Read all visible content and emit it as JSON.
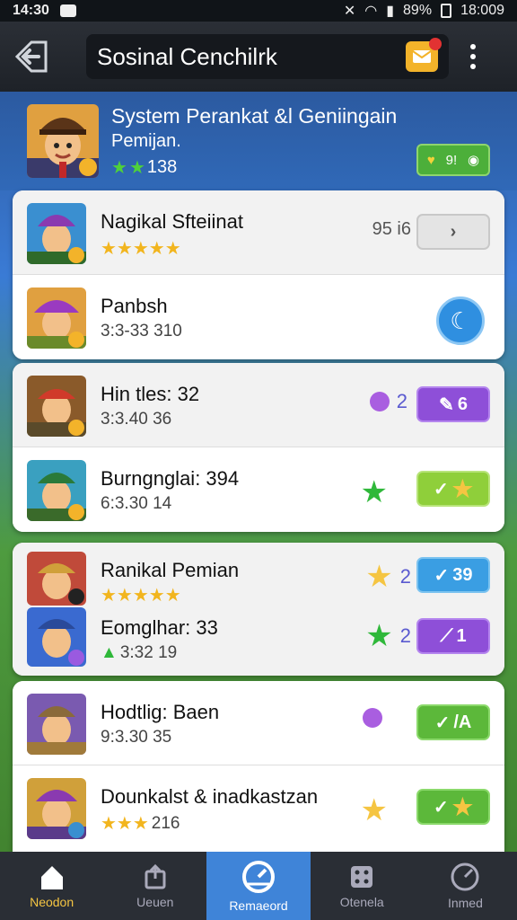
{
  "status": {
    "time": "14:30",
    "battery": "89%",
    "clock": "18:009"
  },
  "header": {
    "title": "Sosinal Cenchilrk"
  },
  "profile": {
    "title": "System Perankat &l Geniingain",
    "subtitle": "Pemijan.",
    "rating": "138",
    "coins": "9!"
  },
  "cards": [
    {
      "rows": [
        {
          "name": "Nagikal Sfteiinat",
          "sub": "",
          "stars": 5,
          "side": "95 i6",
          "action": ""
        },
        {
          "name": "Panbsh",
          "sub": "3:3-33 310",
          "action": ""
        }
      ]
    },
    {
      "rows": [
        {
          "name": "Hin tles: 32",
          "sub": "3:3.40 36",
          "mid": "2",
          "action": "6"
        },
        {
          "name": "Burngnglai: 394",
          "sub": "6:3.30 14",
          "action": ""
        }
      ]
    },
    {
      "rows": [
        {
          "name": "Ranikal Pemian",
          "sub": "",
          "stars": 5,
          "mid": "2",
          "action": "39"
        },
        {
          "name": "Eomglhar: 33",
          "sub": "3:32 19",
          "mid": "2",
          "action": "1"
        }
      ]
    },
    {
      "rows": [
        {
          "name": "Hodtlig: Baen",
          "sub": "9:3.30 35",
          "action": "/A"
        },
        {
          "name": "Dounkalst & inadkastzan",
          "sub": "216",
          "stars": 3,
          "action": ""
        }
      ]
    }
  ],
  "nav": [
    {
      "label": "Neodon"
    },
    {
      "label": "Ueuen"
    },
    {
      "label": "Remaeord"
    },
    {
      "label": "Otenela"
    },
    {
      "label": "Inmed"
    }
  ]
}
